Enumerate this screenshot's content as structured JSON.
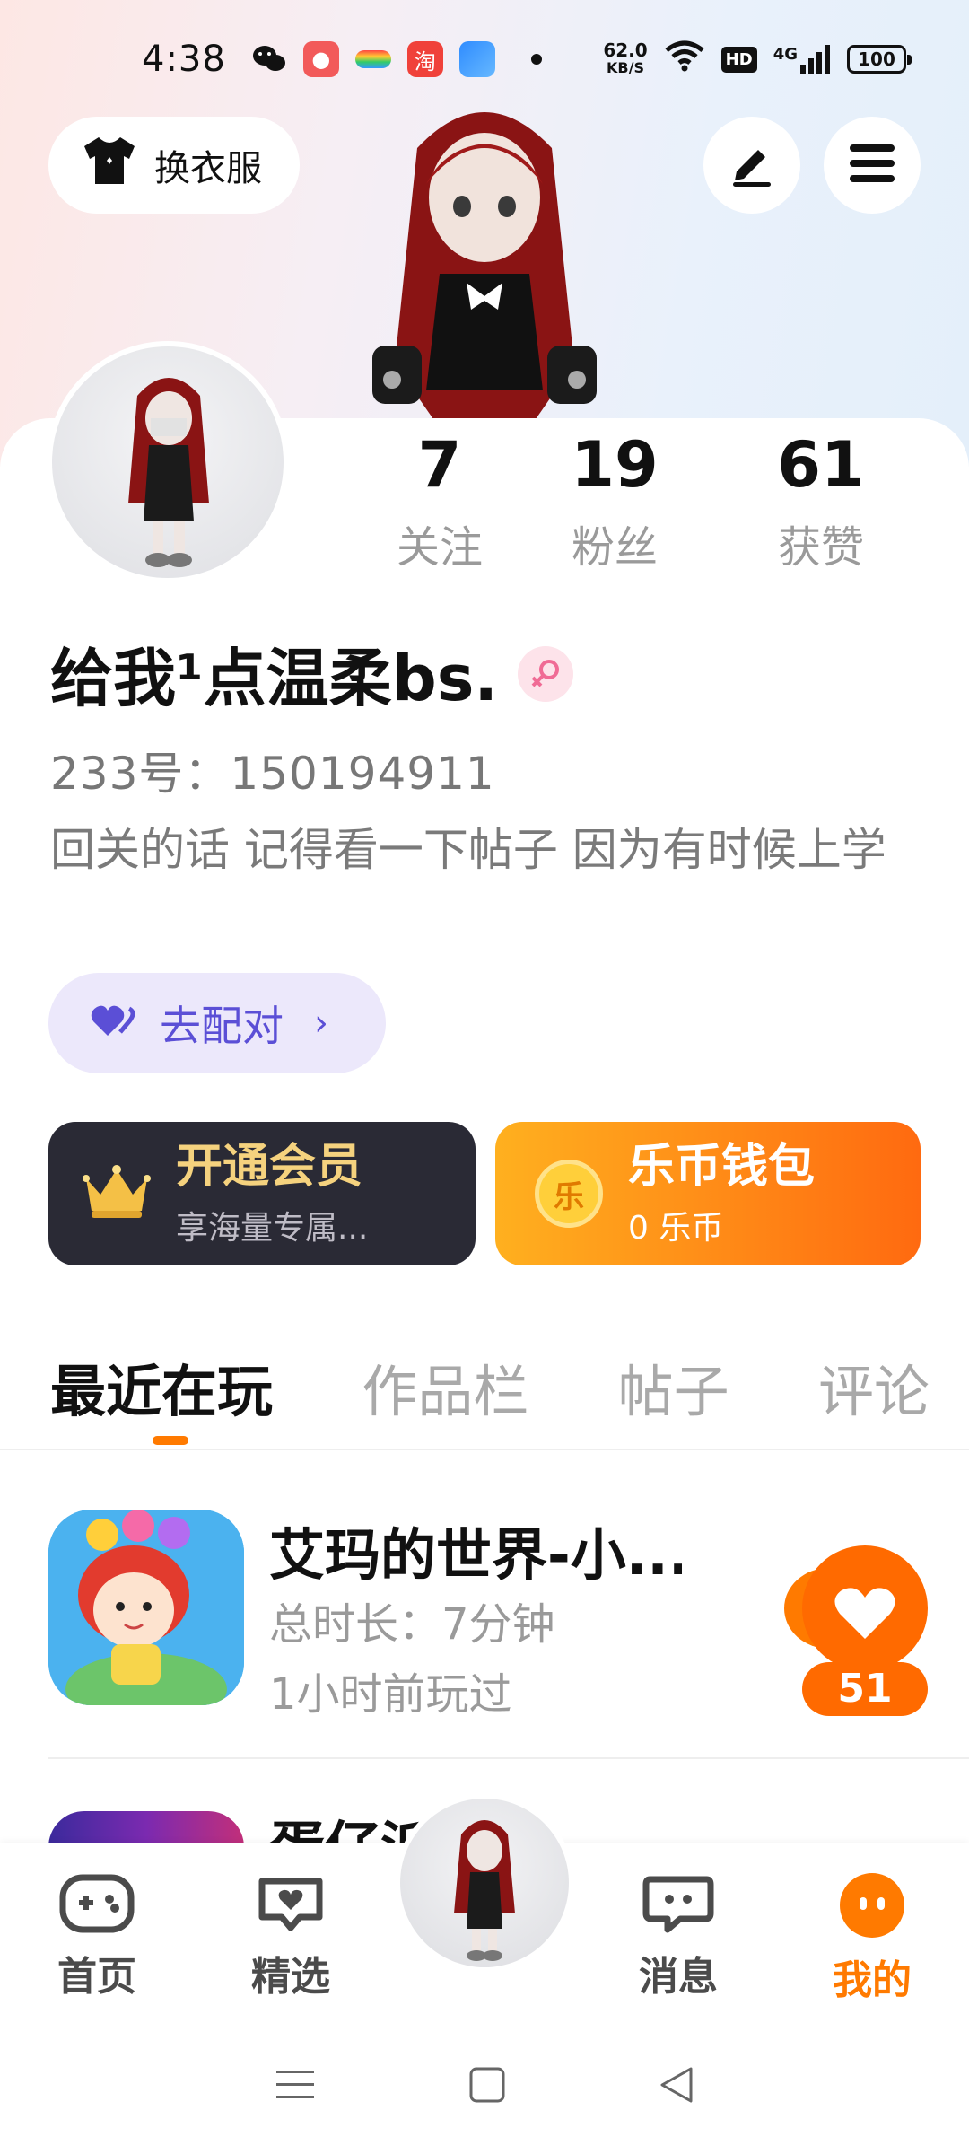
{
  "status_bar": {
    "time": "4:38",
    "net_speed_value": "62.0",
    "net_speed_unit": "KB/S",
    "hd": "HD",
    "network": "4G",
    "battery": "100"
  },
  "header": {
    "dress_label": "换衣服"
  },
  "profile": {
    "stats": [
      {
        "value": "7",
        "label": "关注"
      },
      {
        "value": "19",
        "label": "粉丝"
      },
      {
        "value": "61",
        "label": "获赞"
      }
    ],
    "nickname": "给我¹点温柔bs.",
    "uid": "233号：150194911",
    "bio": "回关的话 记得看一下帖子 因为有时候上学",
    "match_label": "去配对"
  },
  "cards": {
    "vip": {
      "title": "开通会员",
      "subtitle": "享海量专属..."
    },
    "coin": {
      "title": "乐币钱包",
      "subtitle": "0 乐币",
      "coin_glyph": "乐"
    }
  },
  "tabs": [
    {
      "label": "最近在玩",
      "active": true
    },
    {
      "label": "作品栏",
      "active": false
    },
    {
      "label": "帖子",
      "active": false
    },
    {
      "label": "评论",
      "active": false
    }
  ],
  "games": [
    {
      "title": "艾玛的世界-小...",
      "duration": "总时长：7分钟",
      "last_played": "1小时前玩过",
      "likes": "51"
    },
    {
      "title": "蛋仔派"
    }
  ],
  "bottom_nav": [
    {
      "label": "首页",
      "icon": "gamepad-icon",
      "active": false
    },
    {
      "label": "精选",
      "icon": "heart-chat-icon",
      "active": false
    },
    {
      "label": "消息",
      "icon": "message-icon",
      "active": false
    },
    {
      "label": "我的",
      "icon": "profile-face-icon",
      "active": true
    }
  ],
  "colors": {
    "accent": "#ff7a00",
    "match": "#5b4fd6",
    "vip_bg": "#2a2a35",
    "vip_text": "#f5d27e"
  }
}
